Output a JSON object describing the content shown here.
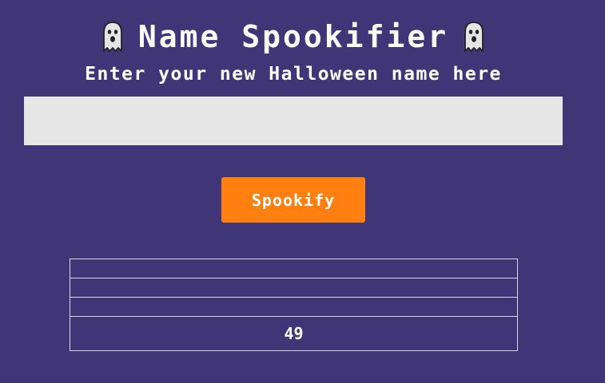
{
  "header": {
    "title": "Name Spookifier",
    "left_icon": "ghost-icon",
    "right_icon": "ghost-icon",
    "subtitle": "Enter your new Halloween name here"
  },
  "form": {
    "name_value": "",
    "name_placeholder": "",
    "submit_label": "Spookify"
  },
  "results": {
    "rows": [
      "",
      "",
      ""
    ],
    "count": "49"
  },
  "colors": {
    "background": "#3f3577",
    "button": "#ff7f11",
    "input": "#e6e6e6",
    "text": "#ffffff"
  }
}
